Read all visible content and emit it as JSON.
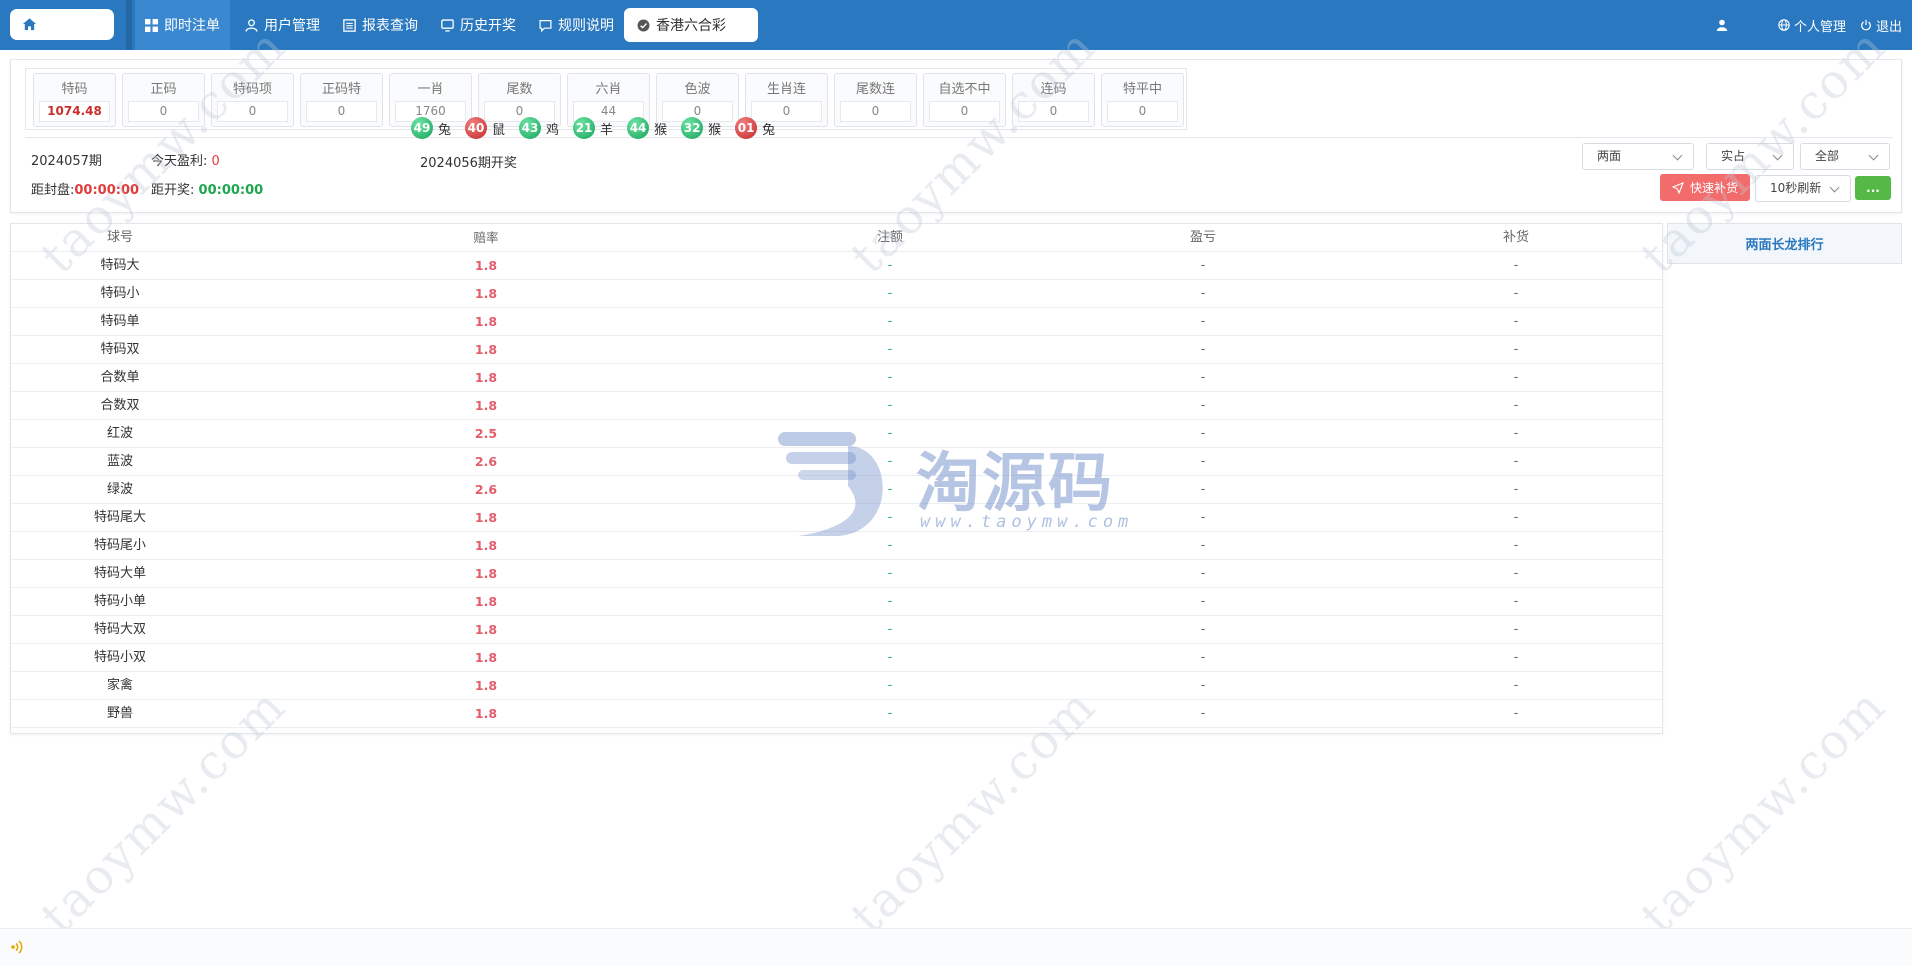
{
  "nav": {
    "items": [
      "即时注单",
      "用户管理",
      "报表查询",
      "历史开奖",
      "规则说明"
    ],
    "lottery": "香港六合彩",
    "profile": "个人管理",
    "logout": "退出"
  },
  "stats": [
    {
      "name": "特码",
      "value": "1074.48"
    },
    {
      "name": "正码",
      "value": "0"
    },
    {
      "name": "特码项",
      "value": "0"
    },
    {
      "name": "正码特",
      "value": "0"
    },
    {
      "name": "一肖",
      "value": "1760"
    },
    {
      "name": "尾数",
      "value": "0"
    },
    {
      "name": "六肖",
      "value": "44"
    },
    {
      "name": "色波",
      "value": "0"
    },
    {
      "name": "生肖连",
      "value": "0"
    },
    {
      "name": "尾数连",
      "value": "0"
    },
    {
      "name": "自选不中",
      "value": "0"
    },
    {
      "name": "连码",
      "value": "0"
    },
    {
      "name": "特平中",
      "value": "0"
    }
  ],
  "period": {
    "current": "2024057期",
    "profit_label": "今天盈利:",
    "profit_value": "0",
    "close_label": "距封盘:",
    "close_time": "00:00:00",
    "open_label": "距开奖:",
    "open_time": "00:00:00",
    "last_draw_title": "2024056期开奖"
  },
  "draw": [
    {
      "num": "49",
      "color": "green",
      "zodiac": "兔"
    },
    {
      "num": "40",
      "color": "red",
      "zodiac": "鼠"
    },
    {
      "num": "43",
      "color": "green",
      "zodiac": "鸡"
    },
    {
      "num": "21",
      "color": "green",
      "zodiac": "羊"
    },
    {
      "num": "44",
      "color": "green",
      "zodiac": "猴"
    },
    {
      "num": "32",
      "color": "green",
      "zodiac": "猴"
    },
    {
      "num": "01",
      "color": "red",
      "zodiac": "兔"
    }
  ],
  "controls": {
    "select_type": "两面",
    "select_mode": "实占",
    "select_scope": "全部",
    "quick_button": "快速补货",
    "refresh": "10秒刷新",
    "more_button": "..."
  },
  "table": {
    "headers": [
      "球号",
      "赔率",
      "注额",
      "盈亏",
      "补货"
    ],
    "rows": [
      {
        "name": "特码大",
        "odds": "1.8",
        "amount": "-",
        "pl": "-",
        "supply": "-"
      },
      {
        "name": "特码小",
        "odds": "1.8",
        "amount": "-",
        "pl": "-",
        "supply": "-"
      },
      {
        "name": "特码单",
        "odds": "1.8",
        "amount": "-",
        "pl": "-",
        "supply": "-"
      },
      {
        "name": "特码双",
        "odds": "1.8",
        "amount": "-",
        "pl": "-",
        "supply": "-"
      },
      {
        "name": "合数单",
        "odds": "1.8",
        "amount": "-",
        "pl": "-",
        "supply": "-"
      },
      {
        "name": "合数双",
        "odds": "1.8",
        "amount": "-",
        "pl": "-",
        "supply": "-"
      },
      {
        "name": "红波",
        "odds": "2.5",
        "amount": "-",
        "pl": "-",
        "supply": "-"
      },
      {
        "name": "蓝波",
        "odds": "2.6",
        "amount": "-",
        "pl": "-",
        "supply": "-"
      },
      {
        "name": "绿波",
        "odds": "2.6",
        "amount": "-",
        "pl": "-",
        "supply": "-"
      },
      {
        "name": "特码尾大",
        "odds": "1.8",
        "amount": "-",
        "pl": "-",
        "supply": "-"
      },
      {
        "name": "特码尾小",
        "odds": "1.8",
        "amount": "-",
        "pl": "-",
        "supply": "-"
      },
      {
        "name": "特码大单",
        "odds": "1.8",
        "amount": "-",
        "pl": "-",
        "supply": "-"
      },
      {
        "name": "特码小单",
        "odds": "1.8",
        "amount": "-",
        "pl": "-",
        "supply": "-"
      },
      {
        "name": "特码大双",
        "odds": "1.8",
        "amount": "-",
        "pl": "-",
        "supply": "-"
      },
      {
        "name": "特码小双",
        "odds": "1.8",
        "amount": "-",
        "pl": "-",
        "supply": "-"
      },
      {
        "name": "家禽",
        "odds": "1.8",
        "amount": "-",
        "pl": "-",
        "supply": "-"
      },
      {
        "name": "野兽",
        "odds": "1.8",
        "amount": "-",
        "pl": "-",
        "supply": "-"
      }
    ]
  },
  "side": {
    "title": "两面长龙排行"
  },
  "watermark": {
    "text": "taoymw.com",
    "logo_title": "淘源码",
    "logo_sub": "www.taoymw.com"
  },
  "colors": {
    "topbar": "#2a79c0",
    "odds": "#e35d6a",
    "amount": "#2fb36f",
    "quick": "#f36c6c",
    "more": "#54b947"
  }
}
